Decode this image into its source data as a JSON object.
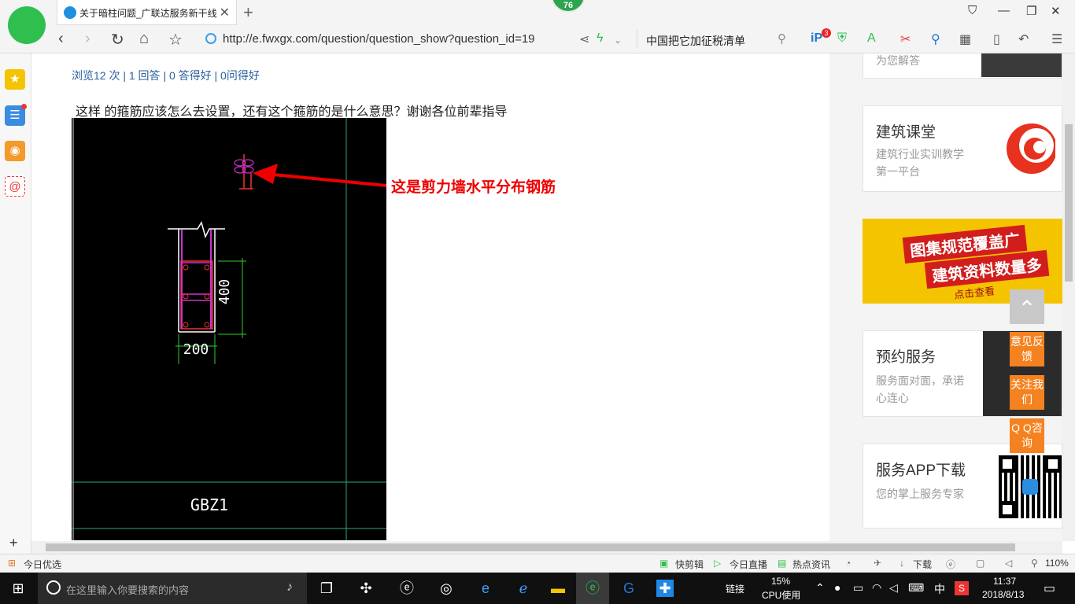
{
  "browser": {
    "tab_title": "关于暗柱问题_广联达服务新干线",
    "new_tab_symbol": "+",
    "badge_count": "76",
    "url": "http://e.fwxgx.com/question/question_show?question_id=19",
    "search_text": "中国把它加征税清单",
    "toolbar_badge": "3",
    "logo_letter": "e"
  },
  "page": {
    "stats": "浏览12 次 | 1 回答 | 0 答得好 | 0问得好",
    "question": "这样  的箍筋应该怎么去设置，还有这个箍筋的是什么意思？谢谢各位前辈指导",
    "annotation": "这是剪力墙水平分布钢筋",
    "cad": {
      "dim_height": "400",
      "dim_width": "200",
      "label": "GBZ1"
    }
  },
  "sidebar_right": {
    "card0_sub": "为您解答",
    "card1": {
      "title": "建筑课堂",
      "sub": "建筑行业实训教学第一平台"
    },
    "promo": {
      "line1": "图集规范覆盖广",
      "line2": "建筑资料数量多",
      "line3": "点击查看"
    },
    "card2": {
      "title": "预约服务",
      "sub": "服务面对面，承诺心连心"
    },
    "card3": {
      "title": "服务APP下载",
      "sub": "您的掌上服务专家"
    }
  },
  "float_buttons": {
    "feedback": "意见反馈",
    "follow": "关注我们",
    "qq": "Q Q咨询"
  },
  "statusbar": {
    "left": "今日优选",
    "kuaijianji": "快剪辑",
    "zhibo": "今日直播",
    "redian": "热点资讯",
    "download": "下载",
    "zoom": "110%"
  },
  "taskbar": {
    "search_placeholder": "在这里输入你要搜索的内容",
    "link_label": "链接",
    "cpu_percent": "15%",
    "cpu_label": "CPU使用",
    "ime": "中",
    "time": "11:37",
    "date": "2018/8/13"
  },
  "colors": {
    "accent_green": "#2fbf4e",
    "link_blue": "#2a5f9e",
    "annotation_red": "#e00000",
    "orange": "#f58220"
  }
}
